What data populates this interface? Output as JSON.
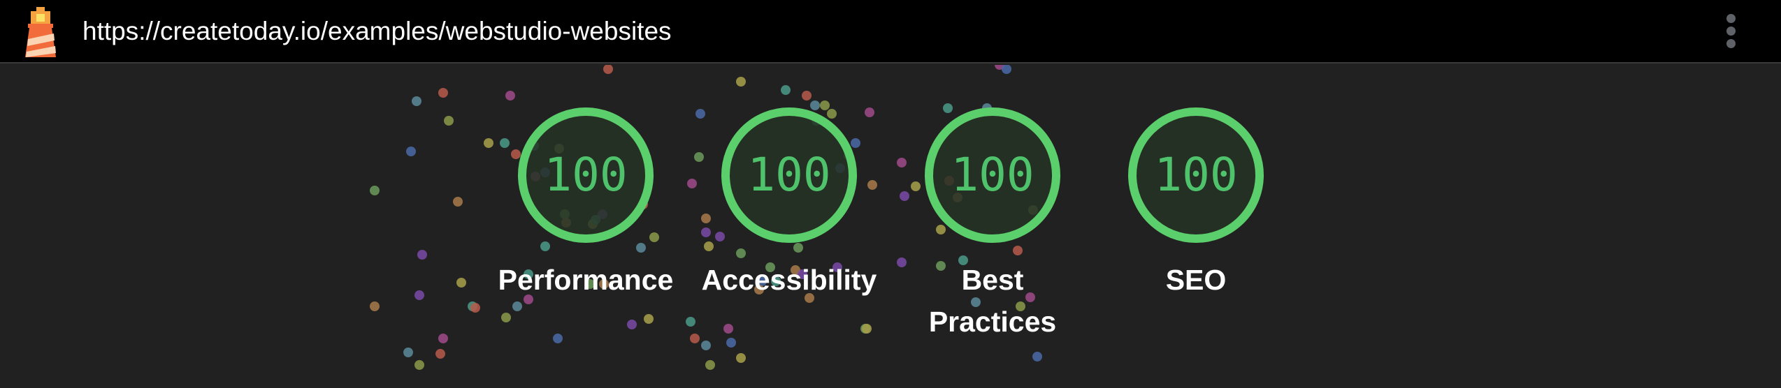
{
  "address_bar": {
    "url": "https://createtoday.io/examples/webstudio-websites",
    "logo_icon": "lighthouse-icon",
    "menu_icon": "more-vertical-icon"
  },
  "scores": [
    {
      "label": "Performance",
      "score": "100"
    },
    {
      "label": "Accessibility",
      "score": "100"
    },
    {
      "label": "Best Practices",
      "score": "100"
    },
    {
      "label": "SEO",
      "score": "100"
    }
  ],
  "colors": {
    "pass": "#5bcf6c",
    "pass_fill": "#2c3a2d",
    "background": "#212121",
    "toolbar": "#000000"
  }
}
